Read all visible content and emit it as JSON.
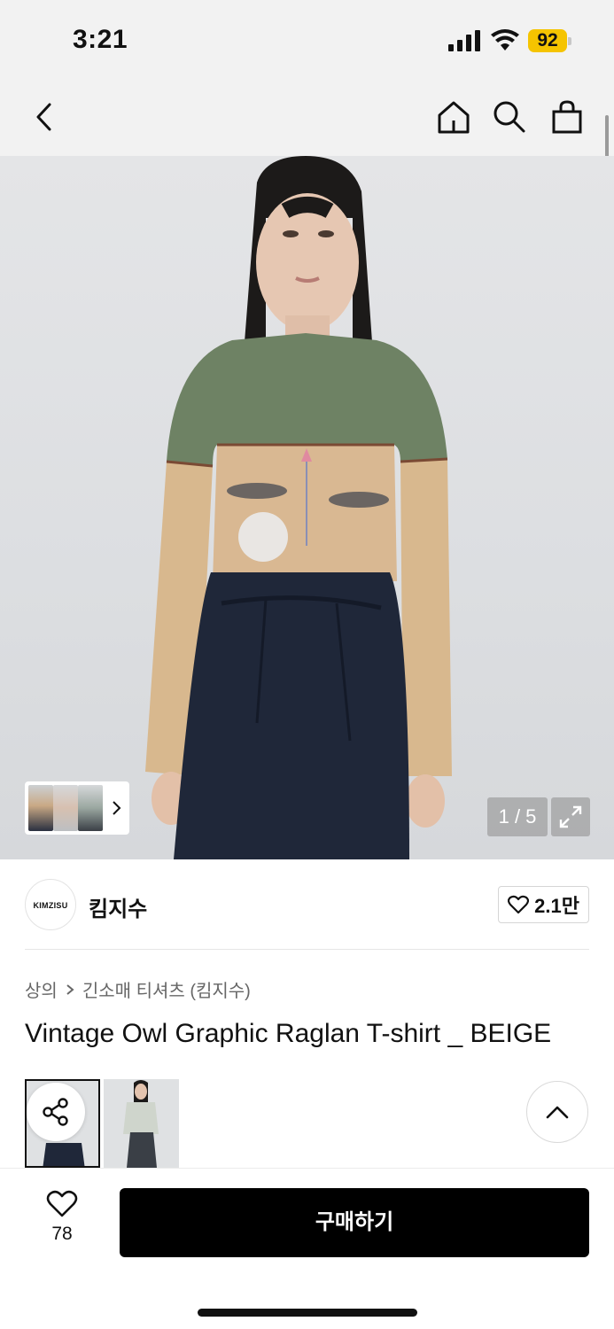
{
  "status_bar": {
    "time": "3:21",
    "battery_level": "92",
    "icons": [
      "signal-icon",
      "wifi-icon",
      "battery-icon"
    ],
    "battery_color": "#f5c400"
  },
  "nav": {
    "icons": [
      "back-icon",
      "home-icon",
      "search-icon",
      "shopping-bag-icon"
    ]
  },
  "gallery": {
    "counter": "1 / 5",
    "current_index": 1,
    "total_images": 5,
    "icons": [
      "chevron-right-icon",
      "expand-icon"
    ]
  },
  "brand": {
    "logo_text": "KIMZISU",
    "name": "킴지수",
    "like_count": "2.1만"
  },
  "breadcrumb": {
    "category": "상의",
    "subcategory": "긴소매 티셔츠 (킴지수)"
  },
  "product": {
    "title": "Vintage Owl Graphic Raglan T-shirt _ BEIGE"
  },
  "actions": {
    "wish_count": "78",
    "buy_label": "구매하기",
    "icons": [
      "share-icon",
      "chevron-up-icon",
      "heart-icon"
    ]
  },
  "colors": {
    "accent": "#000000",
    "battery": "#f5c400",
    "background_bar": "#f2f2f2"
  }
}
